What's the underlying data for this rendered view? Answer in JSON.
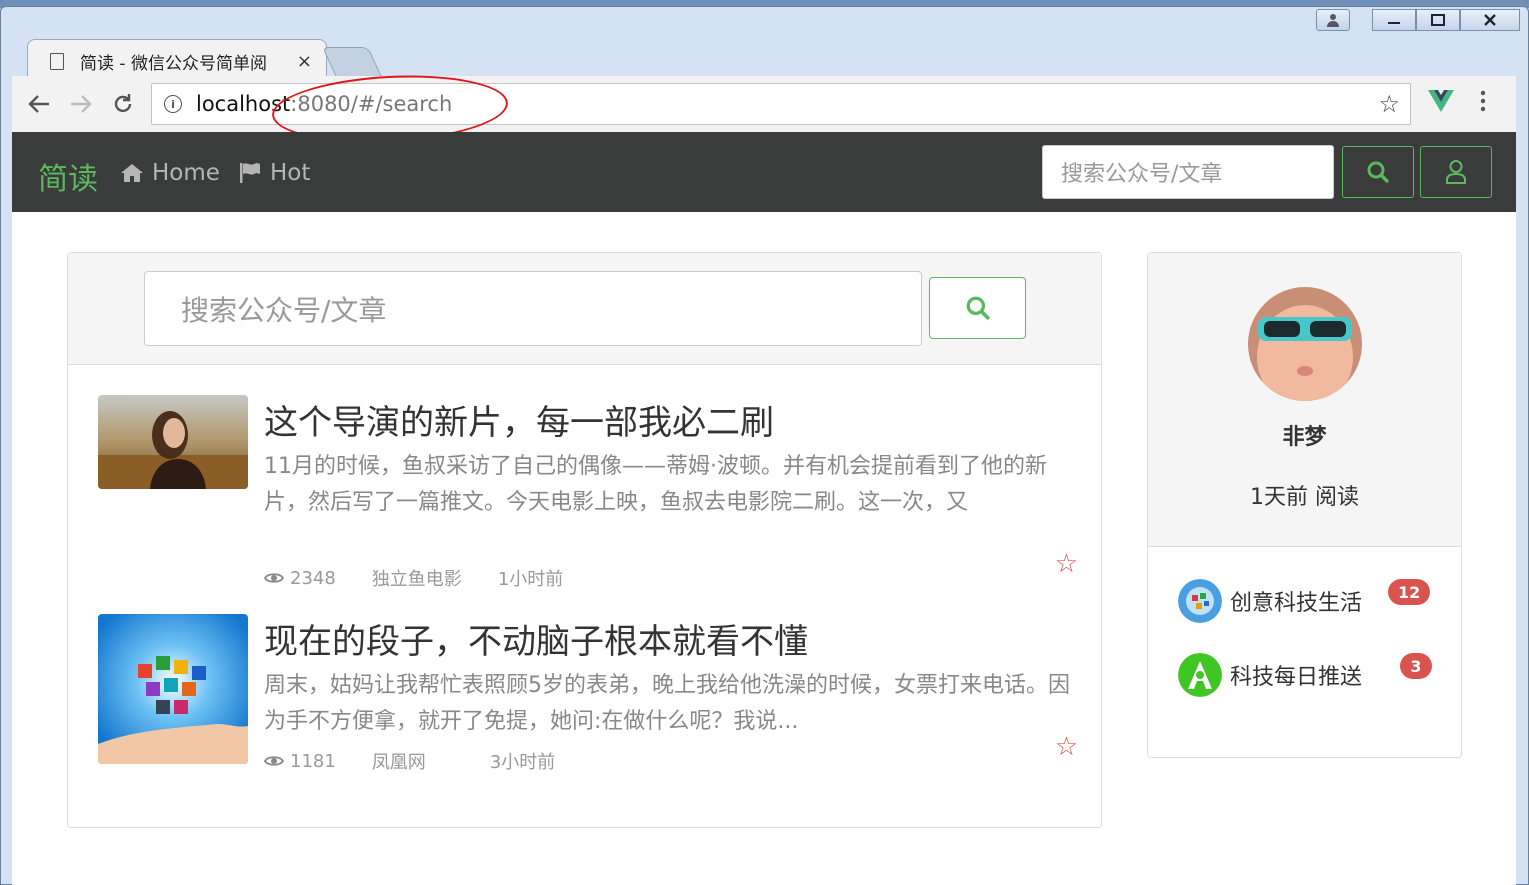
{
  "browser": {
    "tab_title": "简读 - 微信公众号简单阅",
    "tab_close": "×",
    "url_host": "localhost",
    "url_rest": ":8080/#/search"
  },
  "navbar": {
    "brand": "简读",
    "home_label": "Home",
    "hot_label": "Hot",
    "search_placeholder": "搜索公众号/文章"
  },
  "search": {
    "placeholder": "搜索公众号/文章"
  },
  "articles": [
    {
      "title": "这个导演的新片，每一部我必二刷",
      "summary": "11月的时候，鱼叔采访了自己的偶像——蒂姆·波顿。并有机会提前看到了他的新片，然后写了一篇推文。今天电影上映，鱼叔去电影院二刷。这一次，又",
      "views": "2348",
      "source": "独立鱼电影",
      "time": "1小时前"
    },
    {
      "title": "现在的段子，不动脑子根本就看不懂",
      "summary": "周末，姑妈让我帮忙表照顾5岁的表弟，晚上我给他洗澡的时候，女票打来电话。因为手不方便拿，就开了免提，她问:在做什么呢？我说...",
      "views": "1181",
      "source": "凤凰网",
      "time": "3小时前"
    }
  ],
  "profile": {
    "name": "非梦",
    "last_read": "1天前 阅读",
    "subscriptions": [
      {
        "name": "创意科技生活",
        "count": "12"
      },
      {
        "name": "科技每日推送",
        "count": "3"
      }
    ]
  },
  "colors": {
    "accent": "#5cb85c",
    "navbar_bg": "#3a3c3c",
    "badge": "#d9534f",
    "annotation": "#e1141a"
  }
}
